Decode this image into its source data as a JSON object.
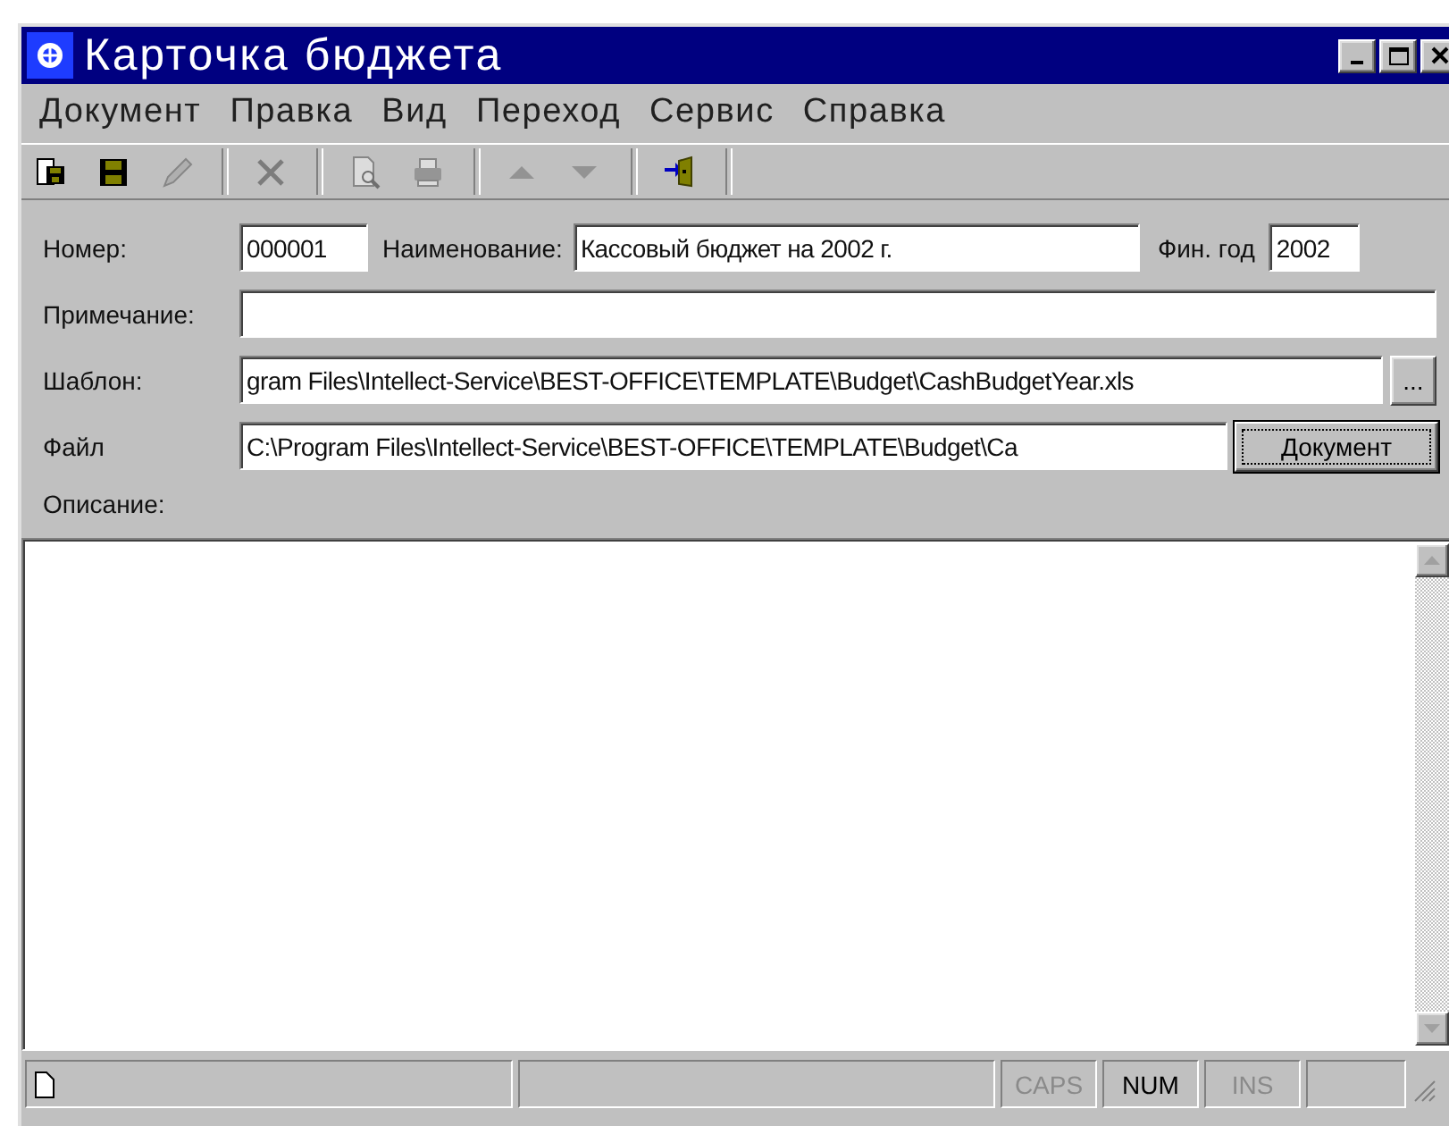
{
  "window": {
    "title": "Карточка бюджета"
  },
  "menu": [
    "Документ",
    "Правка",
    "Вид",
    "Переход",
    "Сервис",
    "Справка"
  ],
  "toolbar": [
    [
      {
        "kind": "open",
        "disabled": false
      },
      {
        "kind": "save",
        "disabled": false
      },
      {
        "kind": "edit",
        "disabled": true
      }
    ],
    [
      {
        "kind": "delete",
        "disabled": true
      }
    ],
    [
      {
        "kind": "preview",
        "disabled": true
      },
      {
        "kind": "print",
        "disabled": true
      }
    ],
    [
      {
        "kind": "up",
        "disabled": true
      },
      {
        "kind": "down",
        "disabled": true
      }
    ],
    [
      {
        "kind": "exit",
        "disabled": false
      }
    ]
  ],
  "form": {
    "number": {
      "label": "Номер:",
      "value": "000001"
    },
    "name": {
      "label": "Наименование:",
      "value": "Кассовый бюджет на 2002 г."
    },
    "year": {
      "label": "Фин. год",
      "value": "2002"
    },
    "note": {
      "label": "Примечание:"
    },
    "template": {
      "label": "Шаблон:",
      "value": "gram Files\\Intellect-Service\\BEST-OFFICE\\TEMPLATE\\Budget\\CashBudgetYear.xls",
      "button": "..."
    },
    "file": {
      "label": "Файл",
      "value": "C:\\Program Files\\Intellect-Service\\BEST-OFFICE\\TEMPLATE\\Budget\\Ca",
      "button": "Документ"
    },
    "description": {
      "label": "Описание:"
    }
  },
  "status_bar": {
    "indicators": [
      {
        "label": "CAPS",
        "on": false
      },
      {
        "label": "NUM",
        "on": true
      },
      {
        "label": "INS",
        "on": false
      }
    ]
  }
}
